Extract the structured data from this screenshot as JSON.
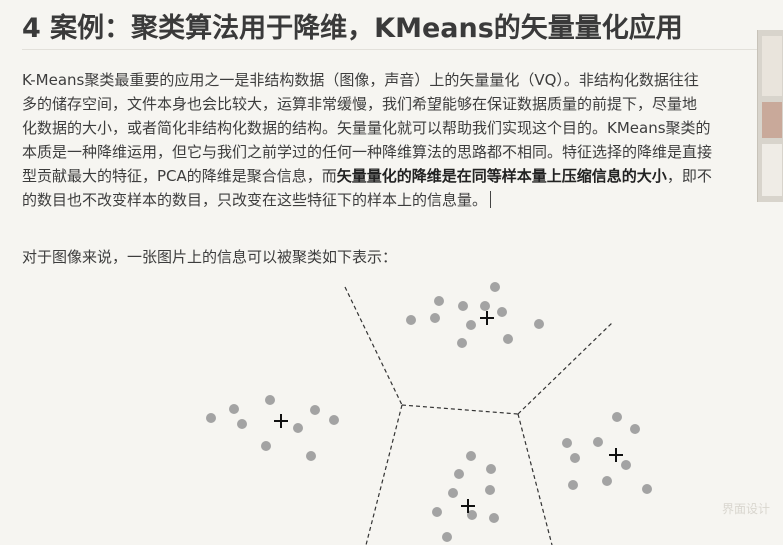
{
  "heading": "4 案例：聚类算法用于降维，KMeans的矢量量化应用",
  "paragraph": {
    "line1": "K-Means聚类最重要的应用之一是非结构数据（图像，声音）上的矢量量化（VQ）。非结构化数据往往",
    "line2": "多的储存空间，文件本身也会比较大，运算非常缓慢，我们希望能够在保证数据质量的前提下，尽量地",
    "line3": "化数据的大小，或者简化非结构化数据的结构。矢量量化就可以帮助我们实现这个目的。KMeans聚类的",
    "line4": "本质是一种降维运用，但它与我们之前学过的任何一种降维算法的思路都不相同。特征选择的降维是直接",
    "line5_a": "型贡献最大的特征，PCA的降维是聚合信息，而",
    "line5_bold": "矢量量化的降维是在同等样本量上压缩信息的大小",
    "line5_b": "，即不",
    "line6": "的数目也不改变样本的数目，只改变在这些特征下的样本上的信息量。"
  },
  "paragraph2": "对于图像来说，一张图片上的信息可以被聚类如下表示：",
  "watermark": "界面设计",
  "figure": {
    "point_color": "#a3a3a3",
    "centroid_color": "#111111",
    "boundary_color": "#333333"
  }
}
